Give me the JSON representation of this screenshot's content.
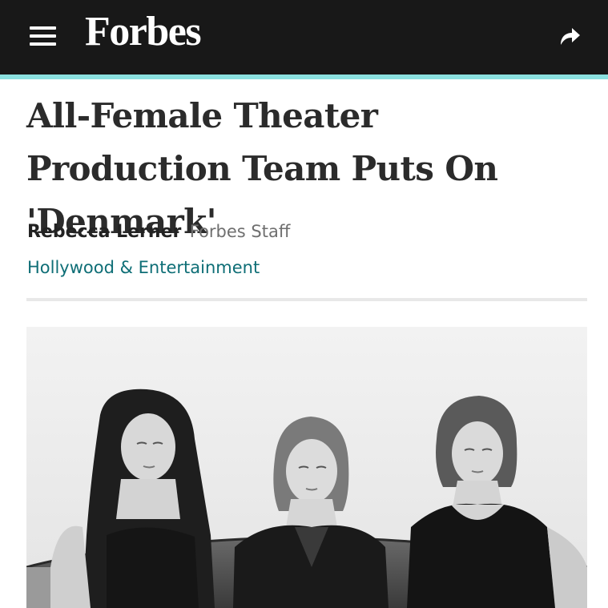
{
  "header": {
    "logo": "Forbes",
    "menu_icon": "hamburger-menu-icon",
    "share_icon": "share-arrow-icon",
    "background_color": "#181818",
    "accent_color": "#8be0df"
  },
  "article": {
    "headline": "All-Female Theater Production Team Puts On 'Denmark'",
    "author": "Rebecca Lerner",
    "author_role": "Forbes Staff",
    "section": "Hollywood & Entertainment",
    "section_color": "#0e6e76"
  }
}
